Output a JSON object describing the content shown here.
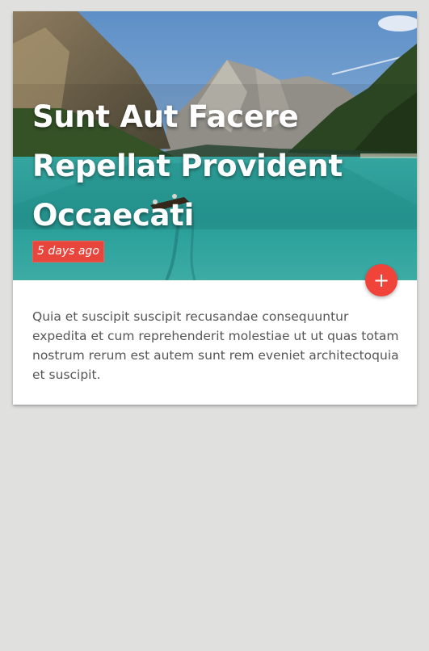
{
  "card": {
    "title": "Sunt Aut Facere Repellat Provident Occaecati",
    "date_badge": "5 days ago",
    "fab_label": "+",
    "body": "Quia et suscipit suscipit recusandae consequuntur expedita et cum reprehenderit molestiae ut ut quas totam nostrum rerum est autem sunt rem eveniet architectoquia et suscipit.",
    "image_icon": "lake-mountain-photo",
    "fab_icon": "plus-icon"
  },
  "colors": {
    "page_background": "#e0e0df",
    "card_background": "#ffffff",
    "accent": "#f0443a",
    "badge": "#e8453c",
    "body_text": "#555555"
  }
}
